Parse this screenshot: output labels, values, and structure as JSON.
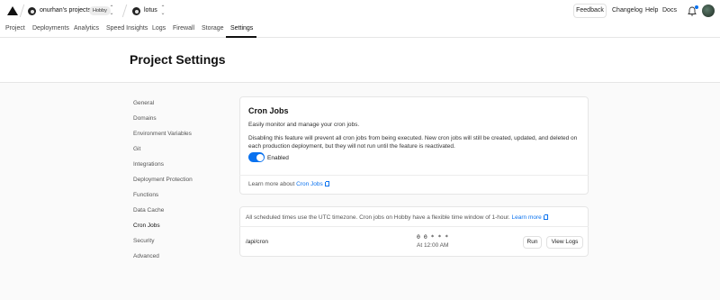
{
  "topbar": {
    "team_name": "onurhan's projects",
    "plan_badge": "Hobby",
    "project_name": "lotus",
    "feedback_label": "Feedback",
    "links": [
      "Changelog",
      "Help",
      "Docs"
    ]
  },
  "nav": {
    "tabs": [
      "Project",
      "Deployments",
      "Analytics",
      "Speed Insights",
      "Logs",
      "Firewall",
      "Storage",
      "Settings"
    ],
    "active_tab": "Settings"
  },
  "page": {
    "title": "Project Settings"
  },
  "sidebar": {
    "items": [
      "General",
      "Domains",
      "Environment Variables",
      "Git",
      "Integrations",
      "Deployment Protection",
      "Functions",
      "Data Cache",
      "Cron Jobs",
      "Security",
      "Advanced"
    ],
    "active": "Cron Jobs"
  },
  "cron_card": {
    "title": "Cron Jobs",
    "subtitle": "Easily monitor and manage your cron jobs.",
    "description": "Disabling this feature will prevent all cron jobs from being executed. New cron jobs will still be created, updated, and deleted on each production deployment, but they will not run until the feature is reactivated.",
    "toggle_label": "Enabled",
    "toggle_on": true,
    "learn_prefix": "Learn more about",
    "learn_link": "Cron Jobs"
  },
  "jobs_card": {
    "note": "All scheduled times use the UTC timezone. Cron jobs on Hobby have a flexible time window of 1-hour.",
    "note_link": "Learn more",
    "jobs": [
      {
        "path": "/api/cron",
        "schedule": "0 0 * * *",
        "time": "At 12:00 AM",
        "run_label": "Run",
        "logs_label": "View Logs"
      }
    ]
  },
  "colors": {
    "accent": "#0a72ef",
    "text": "#111111",
    "muted": "#555555",
    "border": "#e6e6e6"
  }
}
